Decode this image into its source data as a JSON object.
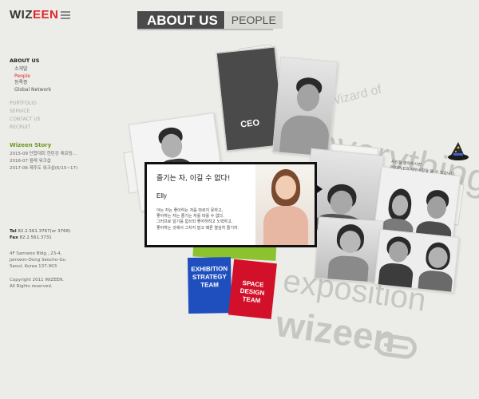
{
  "logo": {
    "text_a": "WIZ",
    "text_b": "EEN"
  },
  "nav": {
    "main": "ABOUT US",
    "sub": [
      {
        "label": "소개말",
        "active": false
      },
      {
        "label": "People",
        "active": true
      },
      {
        "label": "등록증",
        "active": false
      },
      {
        "label": "Global Network",
        "active": false
      }
    ],
    "other": [
      "PORTFOLIO",
      "SERVICE",
      "CONTACT US",
      "RECRUIT"
    ]
  },
  "story": {
    "title": "Wizeen Story",
    "items": [
      "2015-09 단합대회 한탄강 래프팅...",
      "2016-07 월례 워크샵",
      "2017-06 제주도 워크샵(6/15~17)"
    ]
  },
  "contact": {
    "tel_label": "Tel",
    "tel": "82.2.561.3767(or 3768)",
    "fax_label": "Fax",
    "fax": "82.2.561.3731",
    "address": [
      "4F Samwoo Bldg., 23-4,",
      "Jamwon-Dong Seocho-Gu",
      "Seoul, Korea 137-903"
    ],
    "copyright": [
      "Copyright 2011 WIZEEN.",
      "All Rights reserved."
    ]
  },
  "header": {
    "title": "ABOUT US",
    "subtitle": "PEOPLE"
  },
  "background_words": {
    "wizard_of": "Wizard of",
    "everything": "everything",
    "exposition": "exposition",
    "wizeen": "wizeen"
  },
  "panels": {
    "ceo_label": "CEO"
  },
  "teams": {
    "blue": [
      "EXHIBITION",
      "STRATEGY",
      "TEAM"
    ],
    "red": [
      "SPACE",
      "DESIGN",
      "TEAM"
    ]
  },
  "hat_caption": [
    "사진을 클릭하시면",
    "PEOPLE의 세부사항을 볼 수 있습니다."
  ],
  "popup": {
    "heading": "즐기는 자, 이길 수 없다!",
    "name": "Elly",
    "description": [
      "아는 자는 좋아하는 자를 따르지 못하고,",
      "좋아하는 자는 즐기는 자를 따를 수 없다.",
      "그러므로 일기를 힘쓰되 좋아하려고 노력하고,",
      "좋아하는 것에서 그치지 말고 때론 열심히 즐기자."
    ]
  },
  "colors": {
    "accent_red": "#e8232b",
    "story_green": "#6d9a1d",
    "team_green": "#8cc230",
    "team_blue": "#1f4fbe",
    "team_red": "#d3102a",
    "ceo_panel": "#4a4a4a"
  }
}
